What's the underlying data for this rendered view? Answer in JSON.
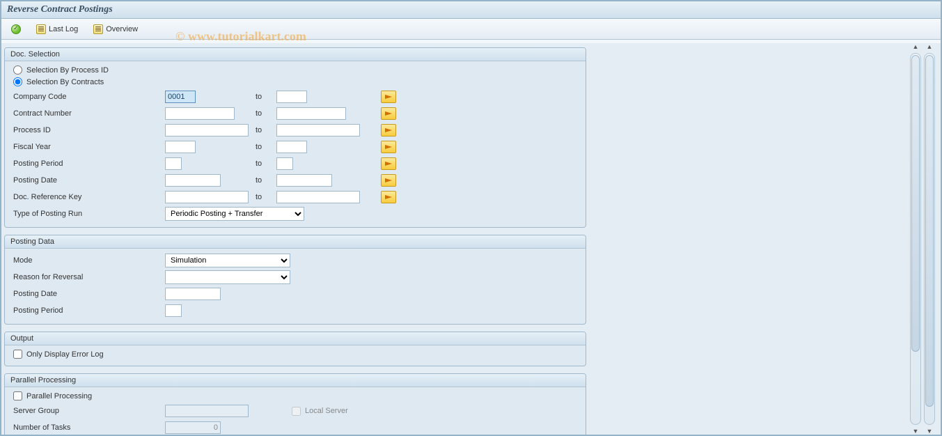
{
  "title": "Reverse Contract Postings",
  "watermark": "© www.tutorialkart.com",
  "toolbar": {
    "exec_label": "",
    "last_log_label": "Last Log",
    "overview_label": "Overview"
  },
  "doc_selection": {
    "title": "Doc. Selection",
    "radio_process": "Selection By Process ID",
    "radio_contracts": "Selection By Contracts",
    "to_label": "to",
    "company_code": {
      "label": "Company Code",
      "from": "0001",
      "to": ""
    },
    "contract_number": {
      "label": "Contract Number",
      "from": "",
      "to": ""
    },
    "process_id": {
      "label": "Process ID",
      "from": "",
      "to": ""
    },
    "fiscal_year": {
      "label": "Fiscal Year",
      "from": "",
      "to": ""
    },
    "posting_period": {
      "label": "Posting Period",
      "from": "",
      "to": ""
    },
    "posting_date": {
      "label": "Posting Date",
      "from": "",
      "to": ""
    },
    "doc_ref_key": {
      "label": "Doc. Reference Key",
      "from": "",
      "to": ""
    },
    "type_run": {
      "label": "Type of Posting Run",
      "value": "Periodic Posting + Transfer"
    }
  },
  "posting_data": {
    "title": "Posting Data",
    "mode": {
      "label": "Mode",
      "value": "Simulation"
    },
    "reason": {
      "label": "Reason for Reversal",
      "value": ""
    },
    "posting_date": {
      "label": "Posting Date",
      "value": ""
    },
    "posting_period": {
      "label": "Posting Period",
      "value": ""
    }
  },
  "output": {
    "title": "Output",
    "only_error": "Only Display Error Log"
  },
  "parallel": {
    "title": "Parallel Processing",
    "enable": "Parallel Processing",
    "server_group": {
      "label": "Server Group",
      "value": ""
    },
    "local_server": "Local Server",
    "num_tasks": {
      "label": "Number of Tasks",
      "value": "0"
    }
  }
}
